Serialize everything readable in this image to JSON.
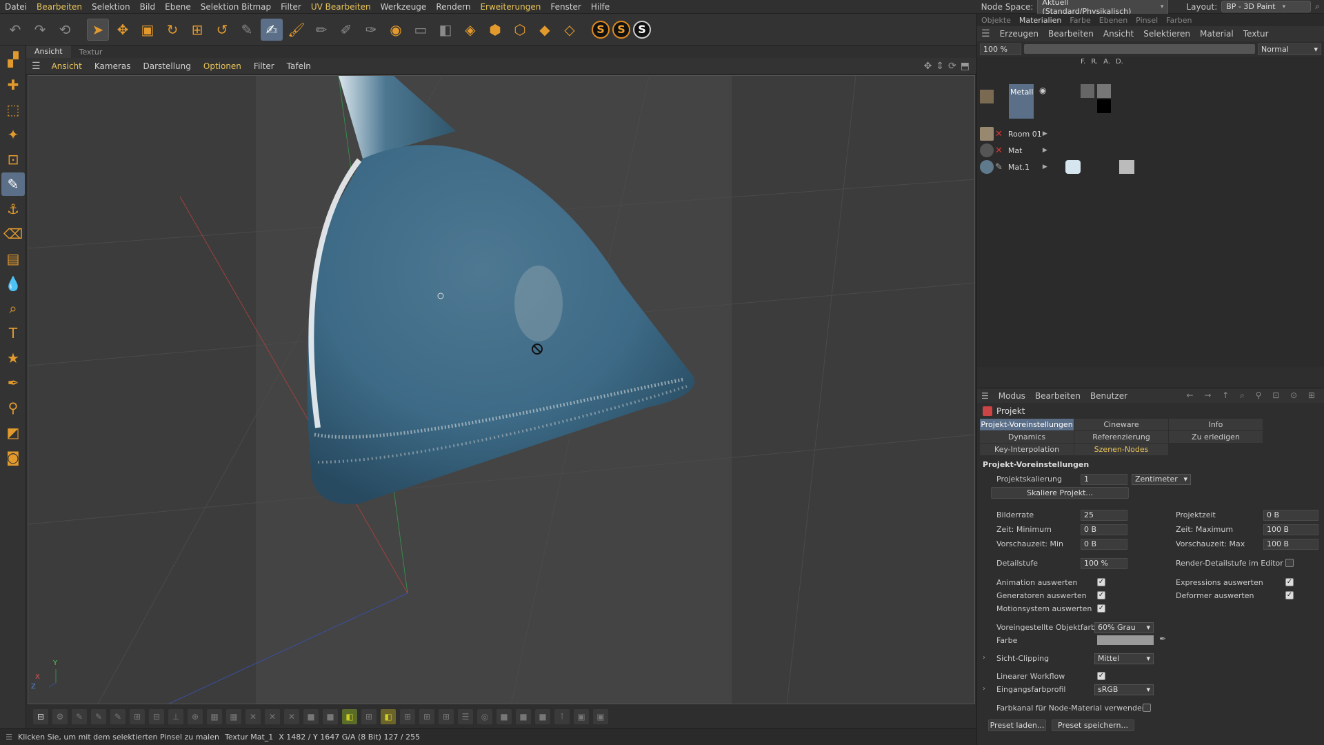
{
  "menu": [
    "Datei",
    "Bearbeiten",
    "Selektion",
    "Bild",
    "Ebene",
    "Selektion Bitmap",
    "Filter",
    "UV Bearbeiten",
    "Werkzeuge",
    "Rendern",
    "Erweiterungen",
    "Fenster",
    "Hilfe"
  ],
  "menu_highlight": [
    "Bearbeiten",
    "UV Bearbeiten",
    "Erweiterungen"
  ],
  "node_space": {
    "label": "Node Space:",
    "value": "Aktuell (Standard/Physikalisch)"
  },
  "layout": {
    "label": "Layout:",
    "value": "BP - 3D Paint"
  },
  "viewport_tabs": [
    "Ansicht",
    "Textur"
  ],
  "viewport_menu": [
    "Ansicht",
    "Kameras",
    "Darstellung",
    "Optionen",
    "Filter",
    "Tafeln"
  ],
  "axis": {
    "y": "Y",
    "x": "X",
    "z": "Z"
  },
  "status": {
    "msg": "Klicken Sie, um mit dem selektierten Pinsel zu malen",
    "tex": "Textur Mat_1",
    "coords": "X 1482 / Y 1647 G/A (8 Bit) 127 / 255"
  },
  "right": {
    "tabs": [
      "Objekte",
      "Materialien",
      "Farbe",
      "Ebenen",
      "Pinsel",
      "Farben"
    ],
    "menu": [
      "Erzeugen",
      "Bearbeiten",
      "Ansicht",
      "Selektieren",
      "Material",
      "Textur"
    ],
    "zoom": "100 %",
    "blend": "Normal",
    "channels": [
      "F.",
      "R.",
      "A.",
      "D."
    ],
    "materials": [
      {
        "name": "Metall"
      },
      {
        "name": "Room 01"
      },
      {
        "name": "Mat"
      },
      {
        "name": "Mat.1"
      }
    ]
  },
  "attr": {
    "menu": [
      "Modus",
      "Bearbeiten",
      "Benutzer"
    ],
    "title": "Projekt",
    "tabs": [
      "Projekt-Voreinstellungen",
      "Cineware",
      "Info",
      "Dynamics",
      "Referenzierung",
      "Zu erledigen",
      "Key-Interpolation",
      "Szenen-Nodes"
    ],
    "section": "Projekt-Voreinstellungen",
    "projektskalierung": {
      "label": "Projektskalierung",
      "value": "1",
      "unit": "Zentimeter"
    },
    "skaliere": "Skaliere Projekt...",
    "bilderrate": {
      "label": "Bilderrate",
      "value": "25"
    },
    "projektzeit": {
      "label": "Projektzeit",
      "value": "0 B"
    },
    "zeit_min": {
      "label": "Zeit: Minimum",
      "value": "0 B"
    },
    "zeit_max": {
      "label": "Zeit: Maximum",
      "value": "100 B"
    },
    "vor_min": {
      "label": "Vorschauzeit: Min",
      "value": "0 B"
    },
    "vor_max": {
      "label": "Vorschauzeit: Max",
      "value": "100 B"
    },
    "detail": {
      "label": "Detailstufe",
      "value": "100 %"
    },
    "render_detail": "Render-Detailstufe im Editor",
    "anim": "Animation auswerten",
    "expr": "Expressions auswerten",
    "gen": "Generatoren auswerten",
    "deform": "Deformer auswerten",
    "motion": "Motionsystem auswerten",
    "objfarbe": {
      "label": "Voreingestellte Objektfarbe",
      "value": "60% Grau"
    },
    "farbe": "Farbe",
    "clip": {
      "label": "Sicht-Clipping",
      "value": "Mittel"
    },
    "linear": "Linearer Workflow",
    "profil": {
      "label": "Eingangsfarbprofil",
      "value": "sRGB"
    },
    "farbkanal": "Farbkanal für Node-Material verwenden",
    "preset_laden": "Preset laden...",
    "preset_speichern": "Preset speichern..."
  }
}
